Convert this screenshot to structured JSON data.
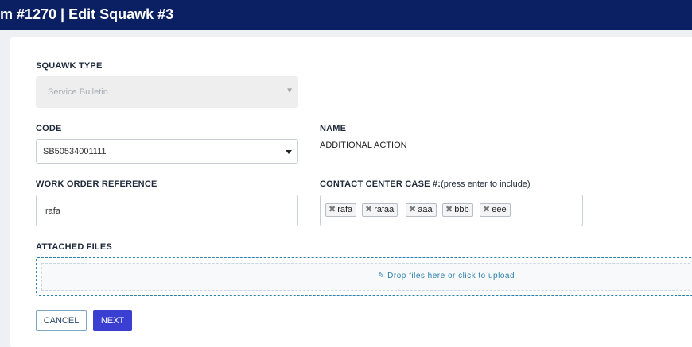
{
  "header": {
    "title": "m #1270 | Edit Squawk #3"
  },
  "form": {
    "squawk_type": {
      "label": "SQUAWK TYPE",
      "value": "Service Bulletin"
    },
    "code": {
      "label": "CODE",
      "value": "SB50534001111"
    },
    "name": {
      "label": "NAME",
      "value": "ADDITIONAL ACTION"
    },
    "work_order": {
      "label": "WORK ORDER REFERENCE",
      "value": "rafa"
    },
    "contact_case": {
      "label": "CONTACT CENTER CASE #:",
      "hint": "(press enter to include)",
      "tags": [
        "rafa",
        "rafaa",
        "aaa",
        "bbb",
        "eee"
      ]
    },
    "attached_files": {
      "label": "ATTACHED FILES",
      "dropzone_text": "Drop files here or click to upload",
      "dropzone_icon": "paperclip-icon"
    }
  },
  "buttons": {
    "cancel": "CANCEL",
    "next": "NEXT"
  },
  "colors": {
    "header_bg": "#0b1f63",
    "primary": "#3a3fd1",
    "dropzone_accent": "#2c7fa8"
  }
}
